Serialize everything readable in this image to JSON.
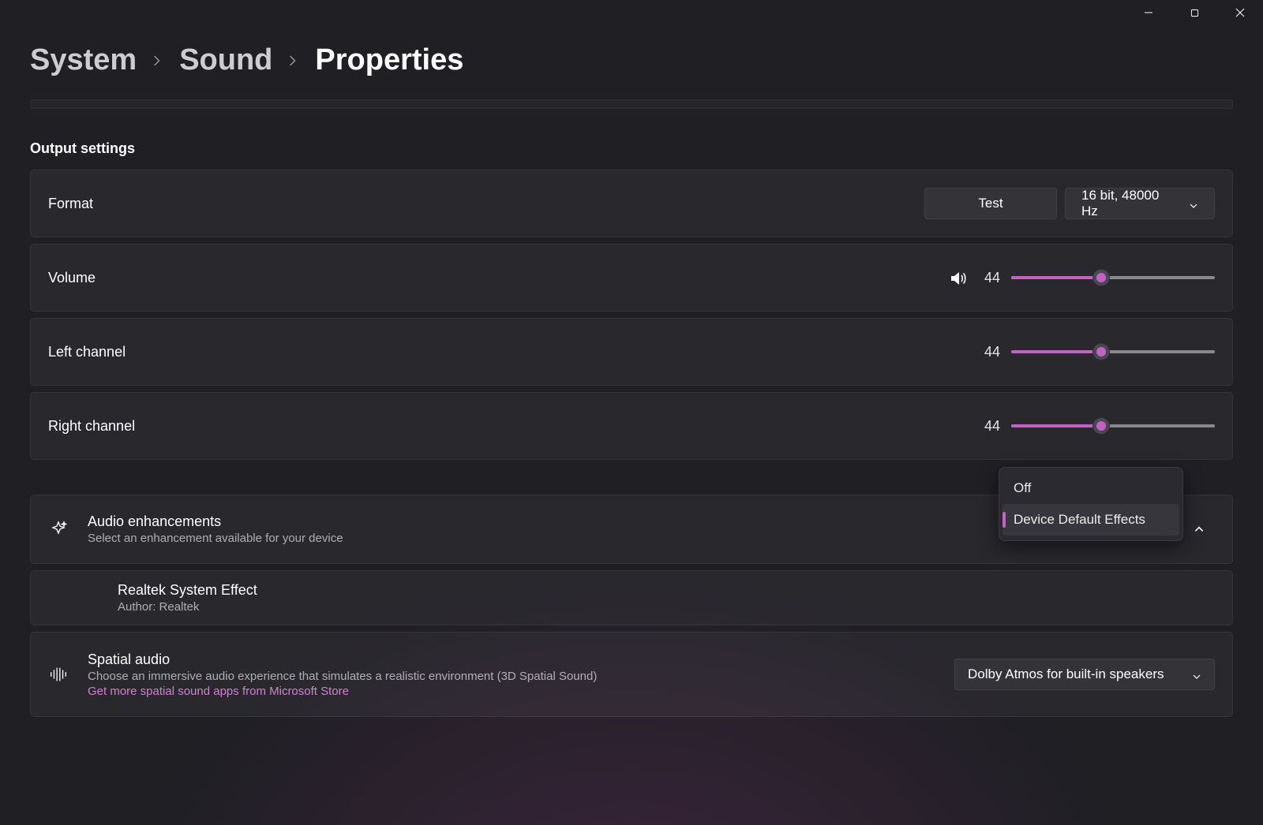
{
  "breadcrumb": {
    "system": "System",
    "sound": "Sound",
    "properties": "Properties"
  },
  "section_title": "Output settings",
  "format": {
    "label": "Format",
    "test_button": "Test",
    "value": "16 bit, 48000 Hz"
  },
  "volume": {
    "label": "Volume",
    "value": "44",
    "percent": 44
  },
  "left_channel": {
    "label": "Left channel",
    "value": "44",
    "percent": 44
  },
  "right_channel": {
    "label": "Right channel",
    "value": "44",
    "percent": 44
  },
  "audio_enhancements": {
    "title": "Audio enhancements",
    "subtitle": "Select an enhancement available for your device",
    "dropdown": {
      "off": "Off",
      "default": "Device Default Effects"
    }
  },
  "realtek": {
    "title": "Realtek System Effect",
    "subtitle": "Author: Realtek"
  },
  "spatial": {
    "title": "Spatial audio",
    "subtitle": "Choose an immersive audio experience that simulates a realistic environment (3D Spatial Sound)",
    "link": "Get more spatial sound apps from Microsoft Store",
    "value": "Dolby Atmos for built-in speakers"
  },
  "colors": {
    "accent": "#c660c6"
  }
}
